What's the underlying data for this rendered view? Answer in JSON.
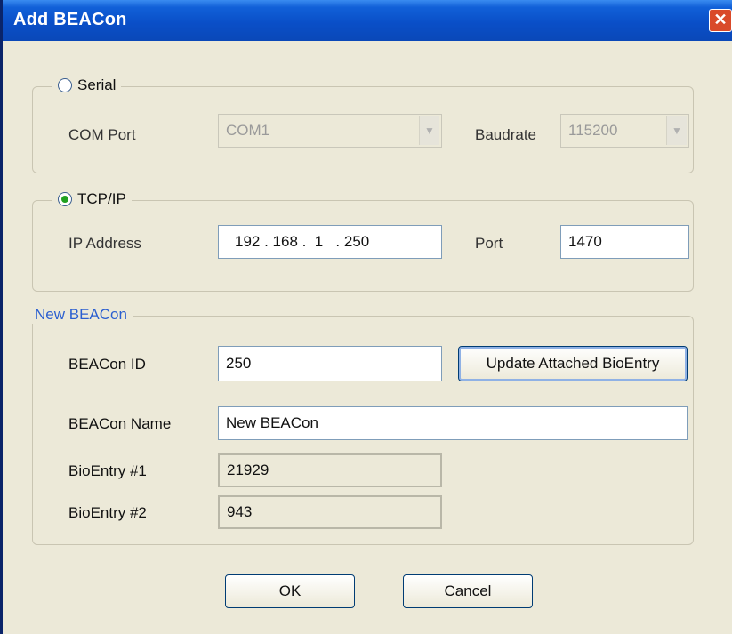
{
  "window": {
    "title": "Add BEACon",
    "close_glyph": "✕"
  },
  "serial": {
    "legend": "Serial",
    "selected": false,
    "com_port_label": "COM Port",
    "com_port_value": "COM1",
    "baudrate_label": "Baudrate",
    "baudrate_value": "115200"
  },
  "tcpip": {
    "legend": "TCP/IP",
    "selected": true,
    "ip_label": "IP Address",
    "ip_value": "192 . 168 .  1   . 250",
    "port_label": "Port",
    "port_value": "1470"
  },
  "new_beacon": {
    "legend": "New BEACon",
    "id_label": "BEACon ID",
    "id_value": "250",
    "update_button": "Update Attached BioEntry",
    "name_label": "BEACon Name",
    "name_value": "New BEACon",
    "bioentry1_label": "BioEntry #1",
    "bioentry1_value": "21929",
    "bioentry2_label": "BioEntry #2",
    "bioentry2_value": "943"
  },
  "buttons": {
    "ok": "OK",
    "cancel": "Cancel"
  },
  "colors": {
    "titlebar": "#0A4FC8",
    "dialog_bg": "#ECE9D8",
    "accent_legend": "#2B5FD0",
    "radio_dot": "#21A121"
  }
}
